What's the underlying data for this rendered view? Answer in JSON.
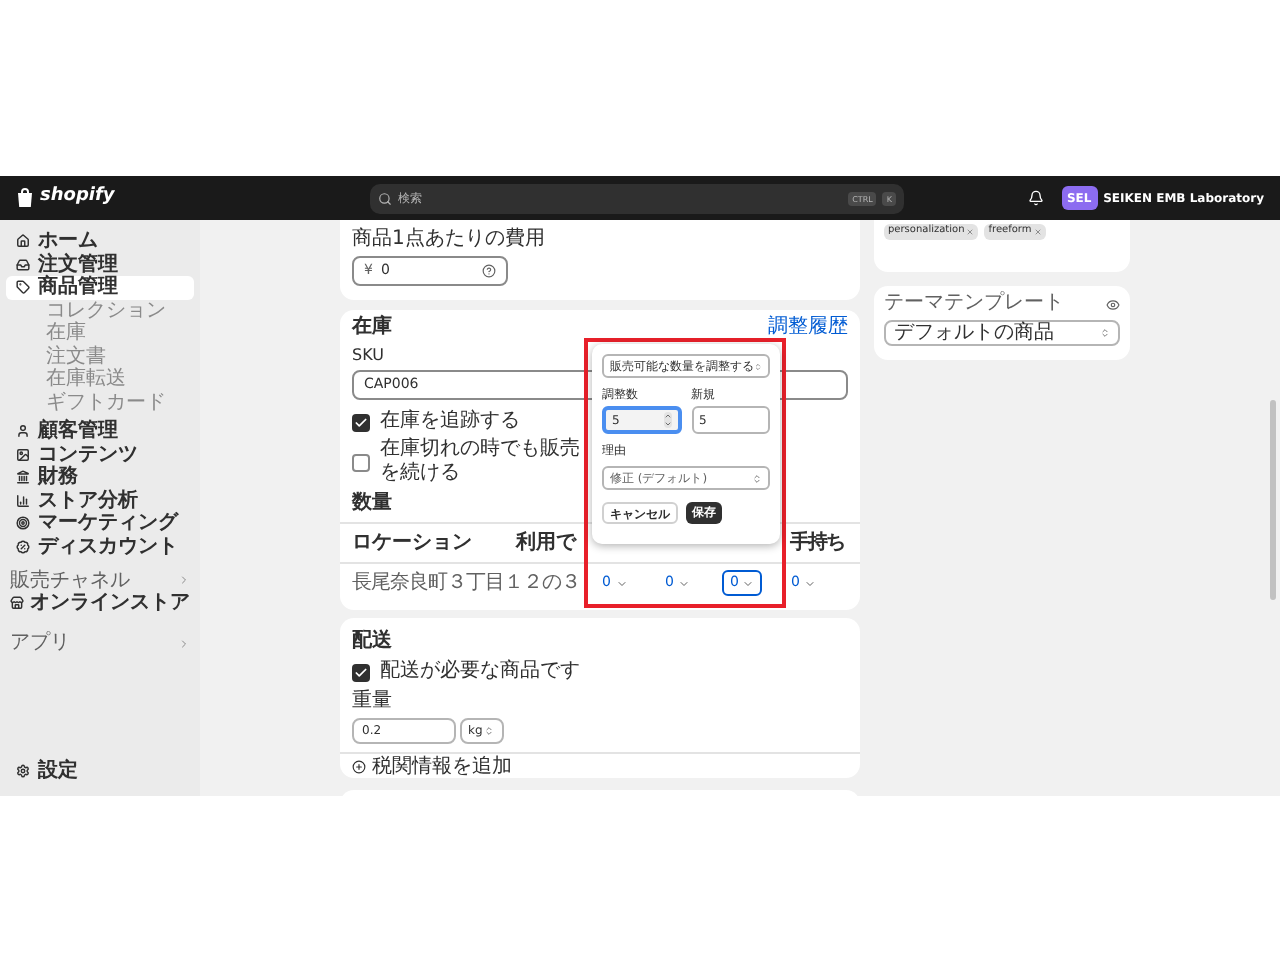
{
  "topbar": {
    "logo": "shopify",
    "search": {
      "placeholder": "検索",
      "keys": [
        "CTRL",
        "K"
      ]
    },
    "account": {
      "initials": "SEL",
      "name": "SEIKEN EMB Laboratory"
    }
  },
  "sidebar": {
    "items": [
      {
        "label": "ホーム",
        "selected": false
      },
      {
        "label": "注文管理",
        "selected": false
      },
      {
        "label": "商品管理",
        "selected": true,
        "children": [
          {
            "label": "コレクション"
          },
          {
            "label": "在庫"
          },
          {
            "label": "注文書"
          },
          {
            "label": "在庫転送"
          },
          {
            "label": "ギフトカード"
          }
        ]
      },
      {
        "label": "顧客管理",
        "selected": false
      },
      {
        "label": "コンテンツ",
        "selected": false
      },
      {
        "label": "財務",
        "selected": false
      },
      {
        "label": "ストア分析",
        "selected": false
      },
      {
        "label": "マーケティング",
        "selected": false
      },
      {
        "label": "ディスカウント",
        "selected": false
      }
    ],
    "sections": [
      {
        "label": "販売チャネル",
        "items": [
          {
            "label": "オンラインストア",
            "selected": false
          }
        ]
      },
      {
        "label": "アプリ"
      }
    ],
    "settings": "設定"
  },
  "cost_card": {
    "label": "商品1点あたりの費用",
    "currency": "¥",
    "value": "0"
  },
  "inventory_card": {
    "title": "在庫",
    "link": "調整履歴",
    "sku_label": "SKU",
    "sku": "CAP006",
    "checkboxes": [
      {
        "label": "在庫を追跡する",
        "checked": true
      },
      {
        "label": "在庫切れの時でも販売を続ける",
        "checked": false
      }
    ],
    "quantity_label": "数量",
    "columns": [
      "ロケーション",
      "利用で",
      "手持ち"
    ],
    "rows": [
      {
        "location": "長尾奈良町３丁目１２の３",
        "quantities": [
          {
            "value": "0",
            "focused": false
          },
          {
            "value": "0",
            "focused": false
          },
          {
            "value": "0",
            "focused": true
          },
          {
            "value": "0",
            "focused": false
          }
        ]
      }
    ]
  },
  "popover": {
    "mode": "販売可能な数量を調整する",
    "adjust_label": "調整数",
    "adjust_value": "5",
    "adjust_focused": true,
    "new_label": "新規",
    "new_value": "5",
    "reason_label": "理由",
    "reason": "修正 (デフォルト)",
    "buttons": [
      {
        "label": "キャンセル",
        "kind": "secondary"
      },
      {
        "label": "保存",
        "kind": "primary"
      }
    ]
  },
  "shipping_card": {
    "title": "配送",
    "checkbox": {
      "label": "配送が必要な商品です",
      "checked": true
    },
    "weight_label": "重量",
    "weight": "0.2",
    "unit": "kg",
    "customs_link": "税関情報を追加"
  },
  "tags": [
    {
      "label": "personalization"
    },
    {
      "label": "freeform"
    }
  ],
  "template_card": {
    "title": "テーマテンプレート",
    "value": "デフォルトの商品"
  }
}
